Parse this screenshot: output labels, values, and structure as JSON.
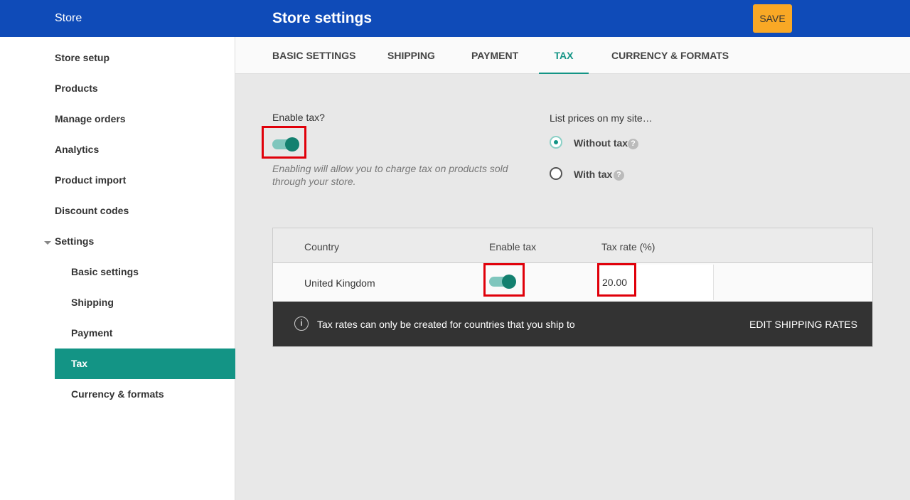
{
  "header": {
    "store": "Store",
    "title": "Store settings",
    "save_label": "SAVE"
  },
  "sidebar": {
    "items": [
      "Store setup",
      "Products",
      "Manage orders",
      "Analytics",
      "Product import",
      "Discount codes",
      "Settings"
    ],
    "sub_items": [
      "Basic settings",
      "Shipping",
      "Payment",
      "Tax",
      "Currency & formats"
    ],
    "active": "Tax"
  },
  "tabs": [
    "BASIC SETTINGS",
    "SHIPPING",
    "PAYMENT",
    "TAX",
    "CURRENCY & FORMATS"
  ],
  "active_tab": "TAX",
  "tax": {
    "enable_label": "Enable tax?",
    "enabled": true,
    "hint": "Enabling will allow you to charge tax on products sold through your store.",
    "list_prices_label": "List prices on my site…",
    "options": [
      "Without tax",
      "With tax"
    ],
    "selected_option": "Without tax"
  },
  "table": {
    "headers": [
      "Country",
      "Enable tax",
      "Tax rate (%)"
    ],
    "rows": [
      {
        "country": "United Kingdom",
        "enabled": true,
        "rate": "20.00"
      }
    ],
    "notice": "Tax rates can only be created for countries that you ship to",
    "notice_link": "EDIT SHIPPING RATES"
  },
  "colors": {
    "header": "#0f4bb8",
    "accent": "#139485",
    "save": "#f9a825",
    "highlight": "#e0000a"
  }
}
